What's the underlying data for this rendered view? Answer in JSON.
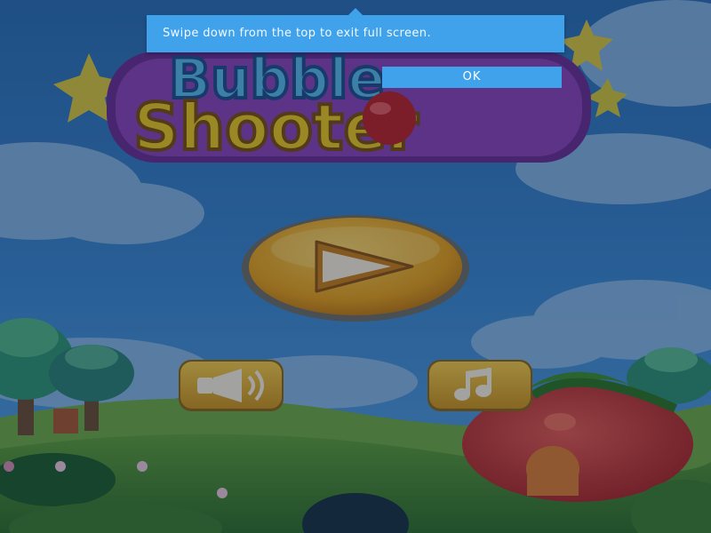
{
  "game": {
    "title_line1": "Bubble",
    "title_line2": "Shooter"
  },
  "buttons": {
    "play_icon": "play-icon",
    "sound_icon": "speaker-icon",
    "music_icon": "music-note-icon"
  },
  "fullscreen_notice": {
    "message": "Swipe down from the top to exit full screen.",
    "ok_label": "OK"
  },
  "colors": {
    "notice_bg": "#3fa2ea",
    "play_button": "#e9a113",
    "button_gold": "#e2b22a",
    "sky": "#2d6fae",
    "grass": "#4a8a2a",
    "strawberry": "#c8352f"
  }
}
